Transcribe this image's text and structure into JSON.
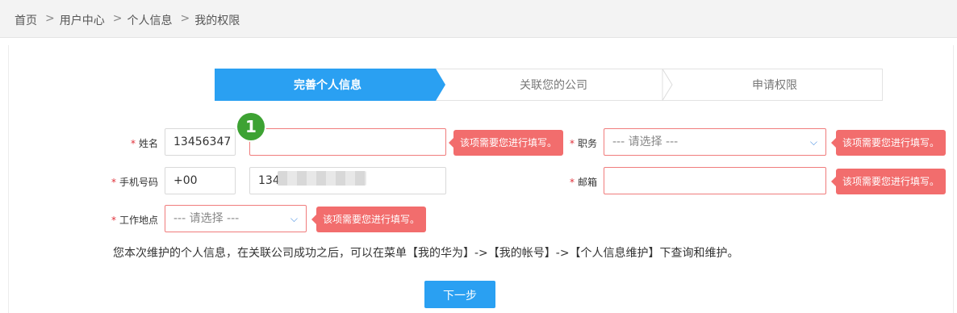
{
  "breadcrumb": {
    "home": "首页",
    "user_center": "用户中心",
    "personal_info": "个人信息",
    "my_permissions": "我的权限",
    "separator": ">"
  },
  "steps": [
    {
      "label": "完善个人信息",
      "state": "active"
    },
    {
      "label": "关联您的公司",
      "state": "pending"
    },
    {
      "label": "申请权限",
      "state": "pending"
    }
  ],
  "form": {
    "required_mark": "*",
    "name": {
      "label": "姓名",
      "first_value": "13456347",
      "second_value": ""
    },
    "position": {
      "label": "职务",
      "placeholder": "--- 请选择 ---"
    },
    "phone": {
      "label": "手机号码",
      "country_code": "+00",
      "number_visible": "134"
    },
    "email": {
      "label": "邮箱",
      "value": ""
    },
    "work_location": {
      "label": "工作地点",
      "placeholder": "--- 请选择 ---"
    },
    "error_tip": "该项需要您进行填写。"
  },
  "annotation_badge": "1",
  "note": "您本次维护的个人信息，在关联公司成功之后，可以在菜单【我的华为】->【我的帐号】->【个人信息维护】下查询和维护。",
  "next_button": "下一步",
  "colors": {
    "accent": "#2aa0f2",
    "error": "#f26d6d",
    "badge": "#3da233"
  }
}
